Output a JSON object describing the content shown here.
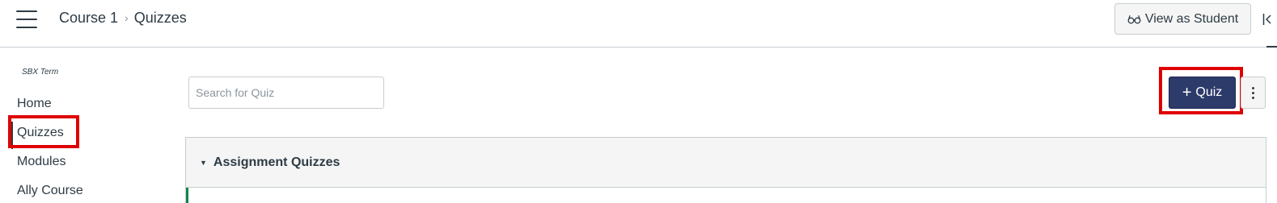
{
  "header": {
    "breadcrumb": {
      "course": "Course 1",
      "separator": "›",
      "current": "Quizzes"
    },
    "view_as_student_label": "View as Student"
  },
  "sidebar": {
    "term": "SBX Term",
    "items": [
      {
        "label": "Home",
        "active": false
      },
      {
        "label": "Quizzes",
        "active": true
      },
      {
        "label": "Modules",
        "active": false
      },
      {
        "label": "Ally Course",
        "active": false
      }
    ]
  },
  "main": {
    "search": {
      "placeholder": "Search for Quiz",
      "value": ""
    },
    "add_quiz_label": "Quiz",
    "add_quiz_icon": "plus-icon",
    "groups": [
      {
        "title": "Assignment Quizzes",
        "expanded": true
      }
    ]
  },
  "colors": {
    "primary_button": "#2d3b6a",
    "highlight_box": "#e00000",
    "published_indicator": "#0b874b",
    "text": "#2d3b45"
  }
}
